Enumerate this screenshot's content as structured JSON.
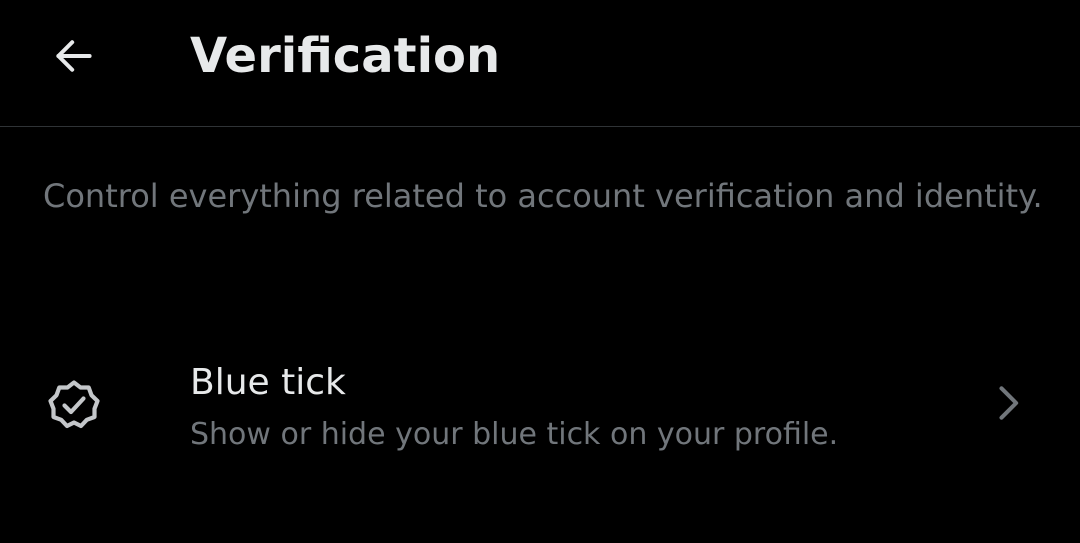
{
  "header": {
    "title": "Verification",
    "back_icon": "arrow-left-icon"
  },
  "description": "Control everything related to account verification and identity.",
  "settings": [
    {
      "title": "Blue tick",
      "subtitle": "Show or hide your blue tick on your profile.",
      "icon": "verified-badge-icon",
      "trailing_icon": "chevron-right-icon"
    }
  ],
  "colors": {
    "background": "#000000",
    "primary_text": "#e7e9ea",
    "secondary_text": "#71767b",
    "divider": "#2f3336"
  }
}
